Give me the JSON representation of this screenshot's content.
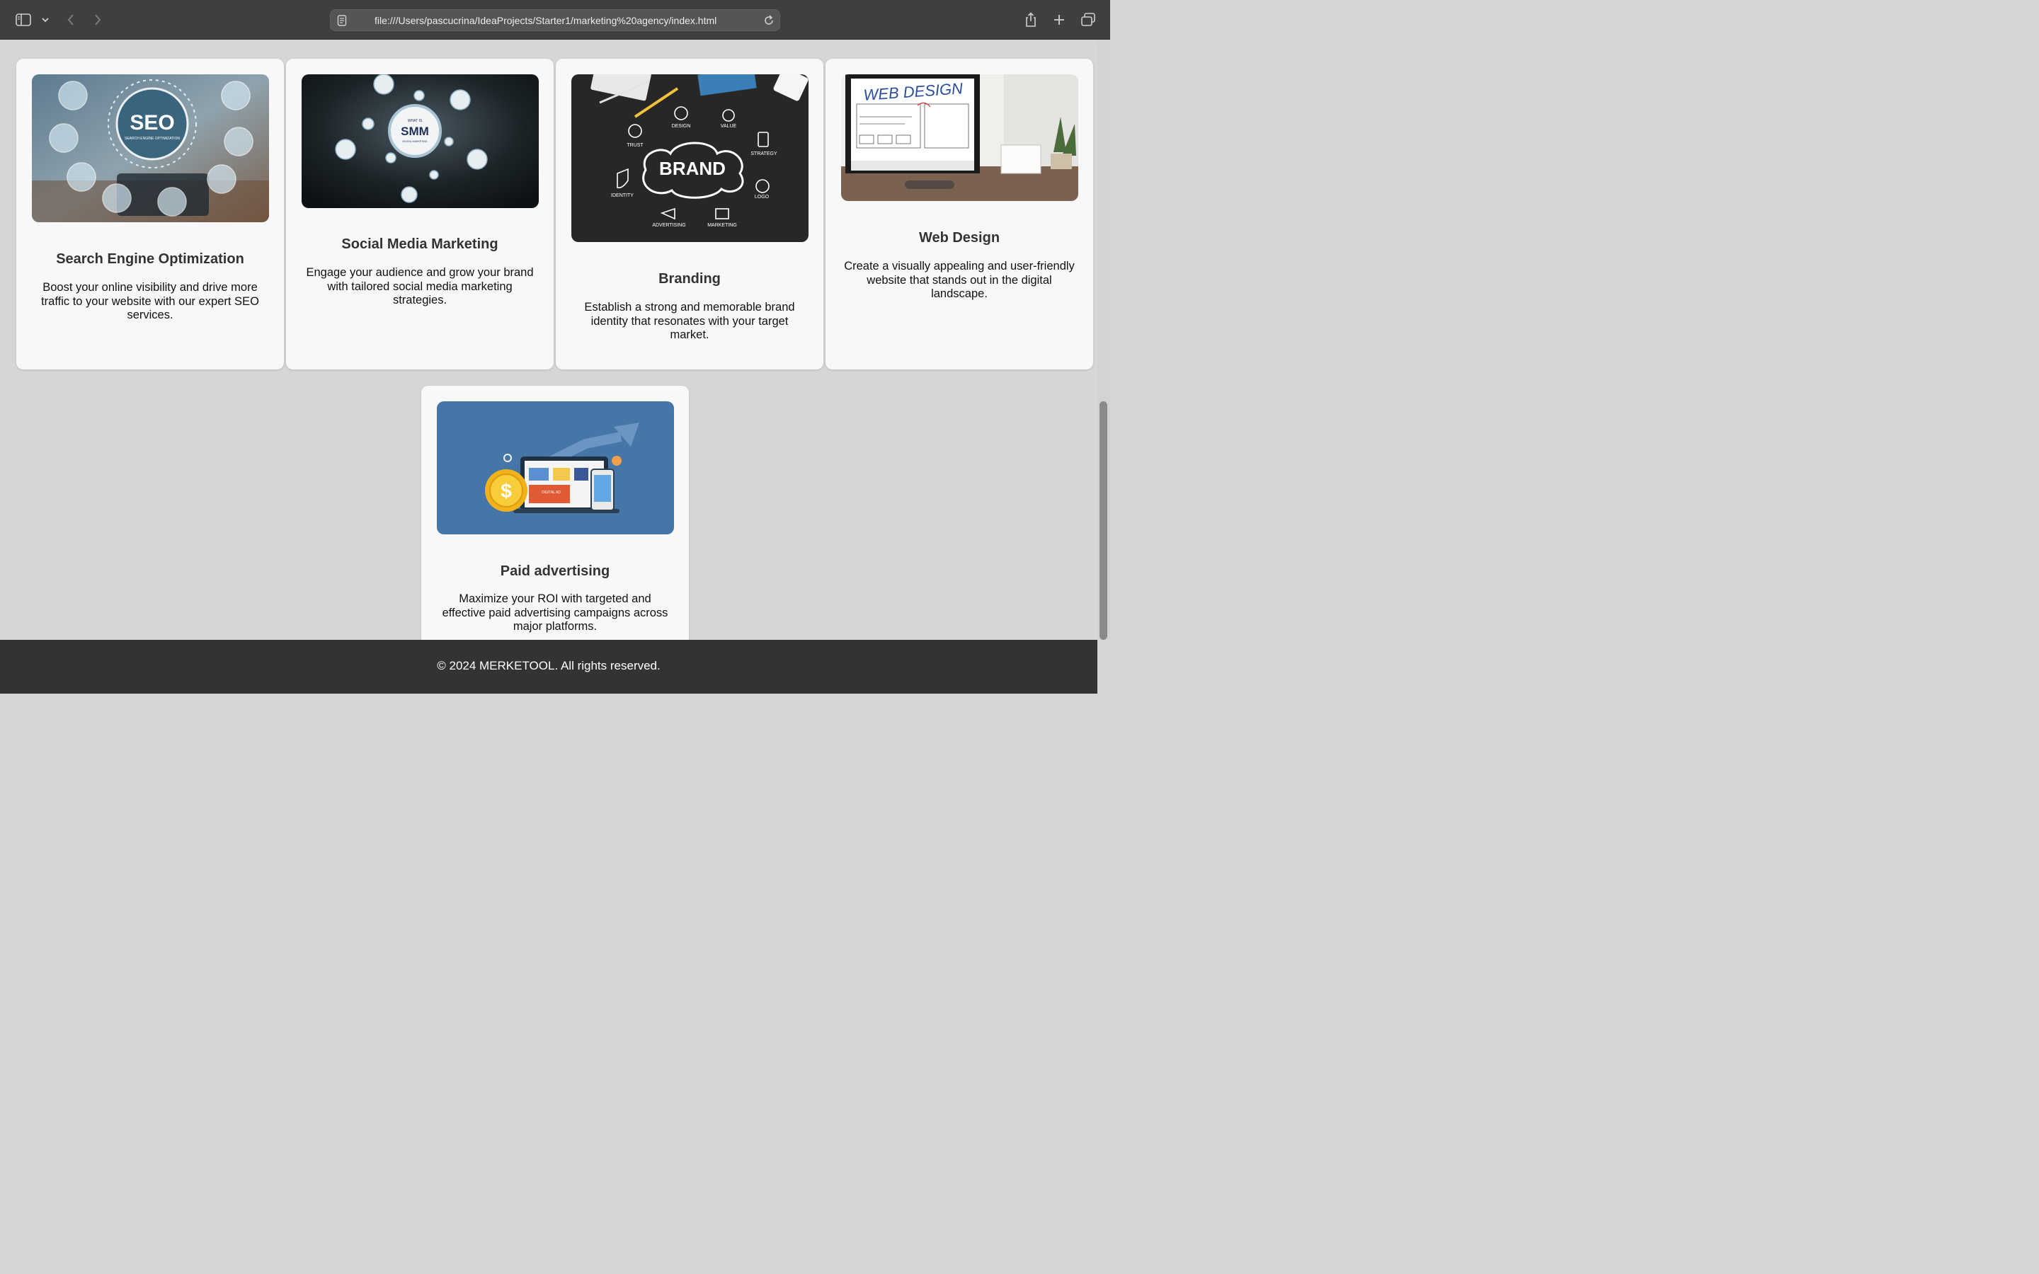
{
  "browser": {
    "url": "file:///Users/pascucrina/IdeaProjects/Starter1/marketing%20agency/index.html"
  },
  "services": [
    {
      "title": "Search Engine Optimization",
      "description": "Boost your online visibility and drive more traffic to your website with our expert SEO services.",
      "image_text": "SEO",
      "image_subtext": "SEARCH ENGINE OPTIMIZATION"
    },
    {
      "title": "Social Media Marketing",
      "description": "Engage your audience and grow your brand with tailored social media marketing strategies.",
      "image_text": "SMM",
      "image_pretext": "WHAT IS",
      "image_subtext": "DIGITAL MARKETING"
    },
    {
      "title": "Branding",
      "description": "Establish a strong and memorable brand identity that resonates with your target market.",
      "image_text": "BRAND",
      "image_labels": [
        "DESIGN",
        "VALUE",
        "TRUST",
        "STRATEGY",
        "IDENTITY",
        "LOGO",
        "ADVERTISING",
        "MARKETING"
      ]
    },
    {
      "title": "Web Design",
      "description": "Create a visually appealing and user-friendly website that stands out in the digital landscape.",
      "image_text": "WEB DESIGN"
    },
    {
      "title": "Paid advertising",
      "description": "Maximize your ROI with targeted and effective paid advertising campaigns across major platforms.",
      "image_text": "DIGITAL AD"
    }
  ],
  "footer": {
    "text": "© 2024 MERKETOOL. All rights reserved."
  }
}
